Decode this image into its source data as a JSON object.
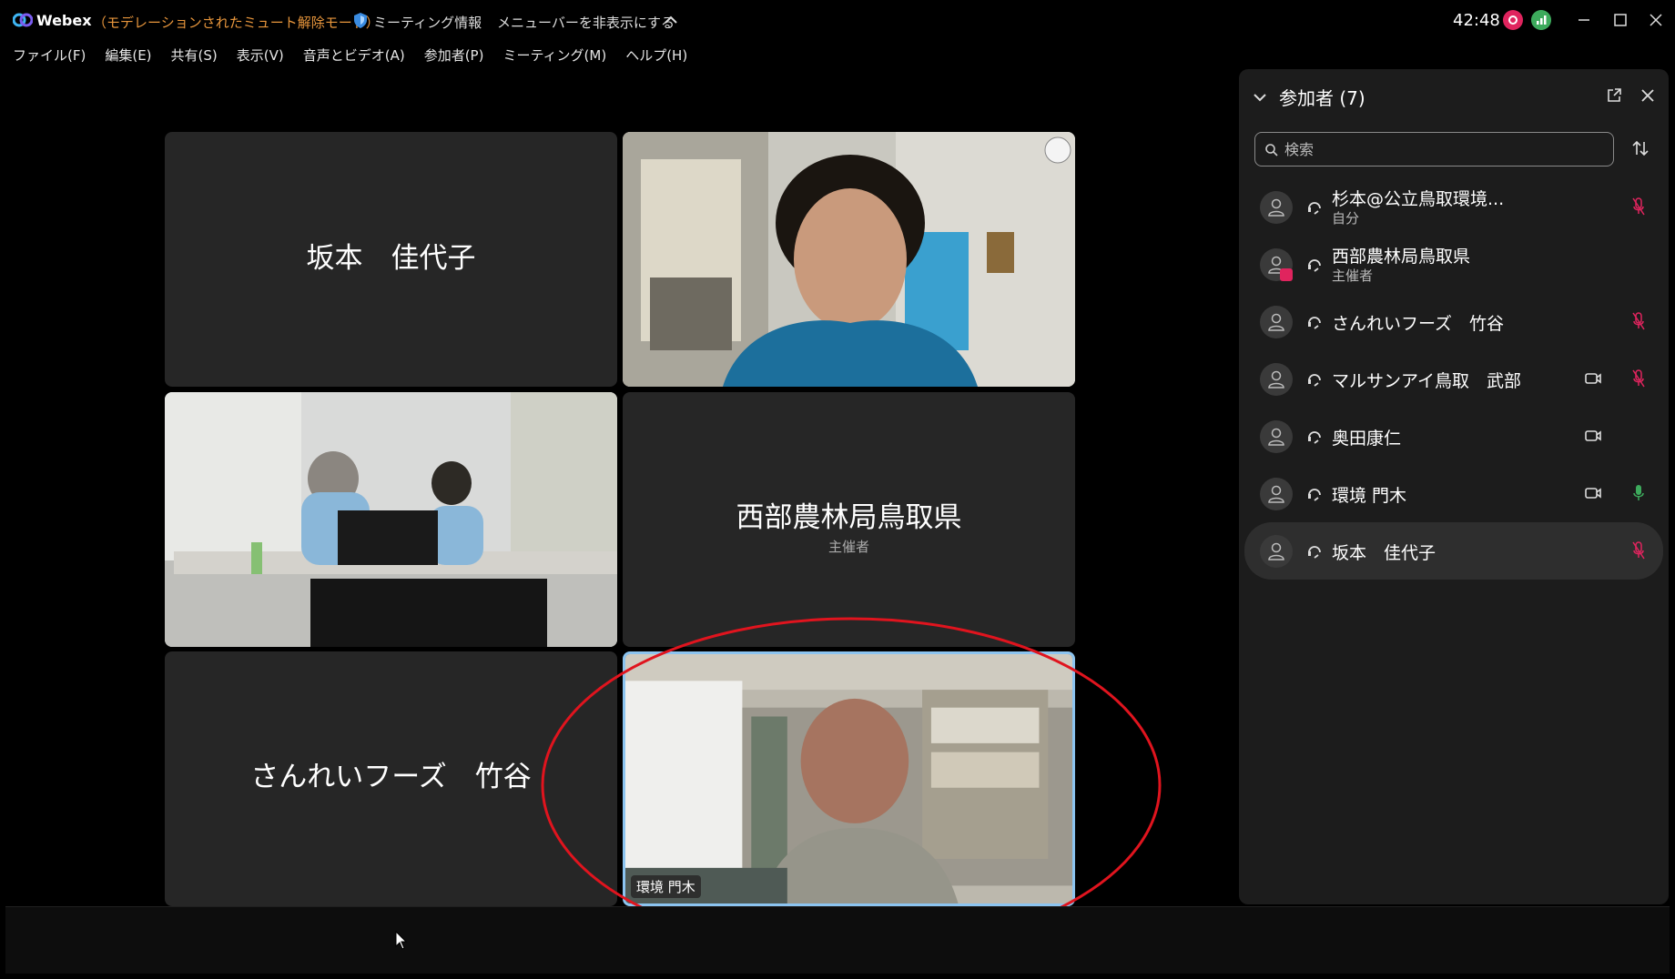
{
  "titlebar": {
    "app_name": "Webex",
    "mode": "（モデレーションされたミュート解除モード）",
    "meeting_info": "ミーティング情報",
    "hide_menu": "メニューバーを非表示にする",
    "timer": "42:48",
    "icons": {
      "logo": "webex-logo-icon",
      "shield": "shield-icon",
      "recording": "recording-icon",
      "network": "network-health-icon"
    }
  },
  "menubar": {
    "items": [
      "ファイル(F)",
      "編集(E)",
      "共有(S)",
      "表示(V)",
      "音声とビデオ(A)",
      "参加者(P)",
      "ミーティング(M)",
      "ヘルプ(H)"
    ]
  },
  "grid": {
    "tiles": [
      {
        "name": "坂本　佳代子",
        "type": "name"
      },
      {
        "type": "video"
      },
      {
        "type": "video"
      },
      {
        "name": "西部農林局鳥取県",
        "sub": "主催者",
        "type": "name"
      },
      {
        "name": "さんれいフーズ　竹谷",
        "type": "name"
      },
      {
        "type": "video",
        "label": "環境 門木",
        "active": true
      }
    ]
  },
  "panel": {
    "title": "参加者 (7)",
    "search_placeholder": "検索",
    "participants": [
      {
        "name": "杉本@公立鳥取環境...",
        "role": "自分",
        "video": false,
        "mic": "muted"
      },
      {
        "name": "西部農林局鳥取県",
        "role": "主催者",
        "video": false,
        "mic": "none",
        "host": true
      },
      {
        "name": "さんれいフーズ　竹谷",
        "role": "",
        "video": false,
        "mic": "muted"
      },
      {
        "name": "マルサンアイ鳥取　武部",
        "role": "",
        "video": true,
        "mic": "muted"
      },
      {
        "name": "奥田康仁",
        "role": "",
        "video": true,
        "mic": "none"
      },
      {
        "name": "環境 門木",
        "role": "",
        "video": true,
        "mic": "active"
      },
      {
        "name": "坂本　佳代子",
        "role": "",
        "video": false,
        "mic": "muted",
        "selected": true
      }
    ]
  },
  "colors": {
    "mode_text": "#e8963c",
    "muted_mic": "#e0245e",
    "active_mic": "#3daa5c",
    "active_speaker_border": "#8cc4f0",
    "annotation": "#e0141e"
  }
}
